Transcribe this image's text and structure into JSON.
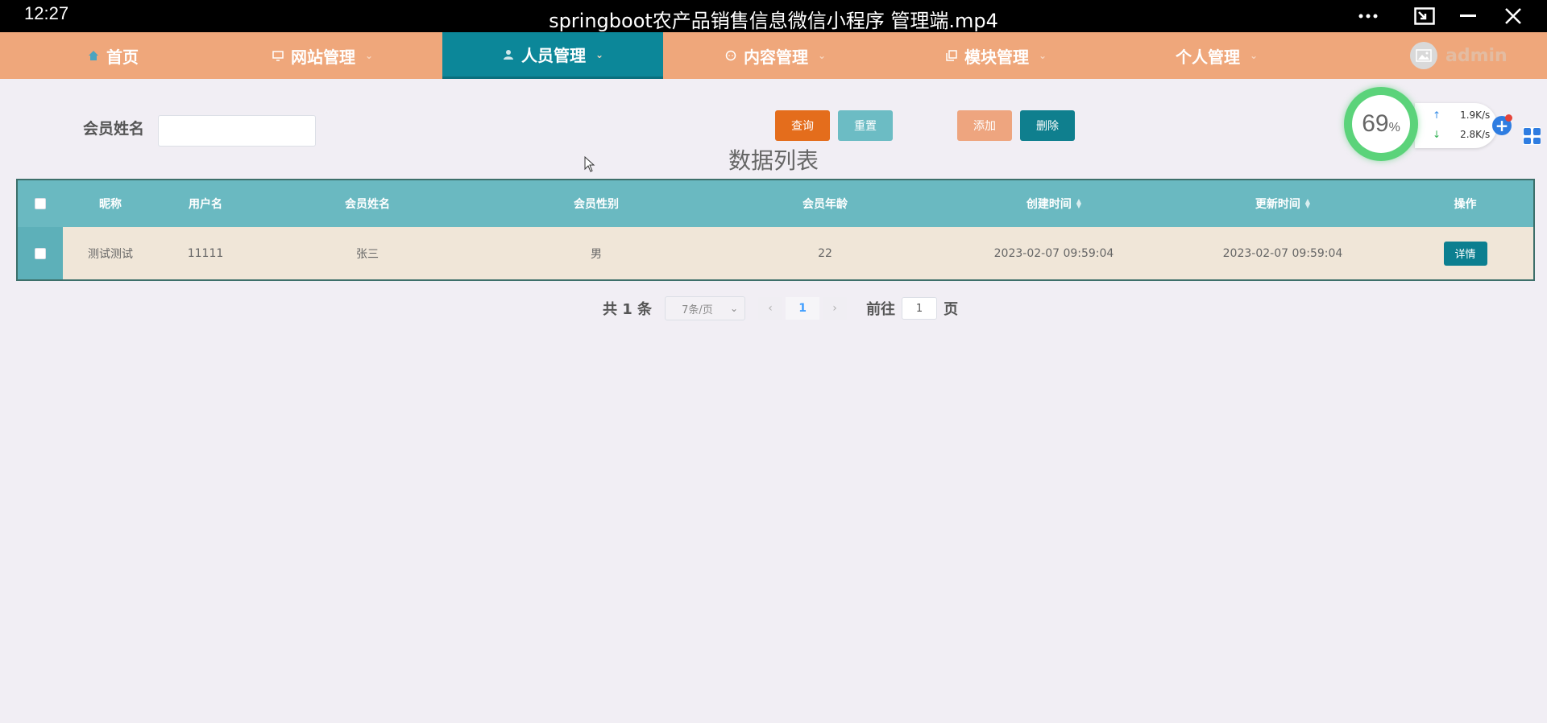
{
  "titlebar": {
    "clock": "12:27",
    "video_title": "springboot农产品销售信息微信小程序 管理端.mp4"
  },
  "nav": {
    "items": [
      {
        "label": "首页",
        "icon": "home-icon"
      },
      {
        "label": "网站管理",
        "icon": "monitor-icon"
      },
      {
        "label": "人员管理",
        "icon": "person-icon"
      },
      {
        "label": "内容管理",
        "icon": "chat-icon"
      },
      {
        "label": "模块管理",
        "icon": "copy-icon"
      },
      {
        "label": "个人管理",
        "icon": ""
      }
    ],
    "active": "人员管理",
    "user": "admin"
  },
  "search": {
    "label": "会员姓名",
    "value": "",
    "query_label": "查询",
    "reset_label": "重置",
    "add_label": "添加",
    "delete_label": "删除"
  },
  "list_title": "数据列表",
  "table": {
    "headers": [
      "昵称",
      "用户名",
      "会员姓名",
      "会员性别",
      "会员年龄",
      "创建时间",
      "更新时间",
      "操作"
    ],
    "rows": [
      {
        "nickname": "测试测试",
        "username": "11111",
        "name": "张三",
        "gender": "男",
        "age": "22",
        "created": "2023-02-07 09:59:04",
        "updated": "2023-02-07 09:59:04",
        "action": "详情"
      }
    ]
  },
  "pagination": {
    "total": "共 1 条",
    "page_size": "7条/页",
    "current_page": "1",
    "goto_label": "前往",
    "goto_value": "1",
    "page_label": "页"
  },
  "speed": {
    "percent": "69",
    "percent_sign": "%",
    "upload": "1.9K/s",
    "download": "2.8K/s"
  },
  "colors": {
    "nav_bg": "#efa77b",
    "nav_active": "#0c8799",
    "table_header": "#6ab9c1",
    "row_bg": "#f0e6d8",
    "query": "#e46d1c",
    "reset": "#6cbcc4",
    "add": "#eea57f",
    "delete": "#0f7f8e"
  }
}
